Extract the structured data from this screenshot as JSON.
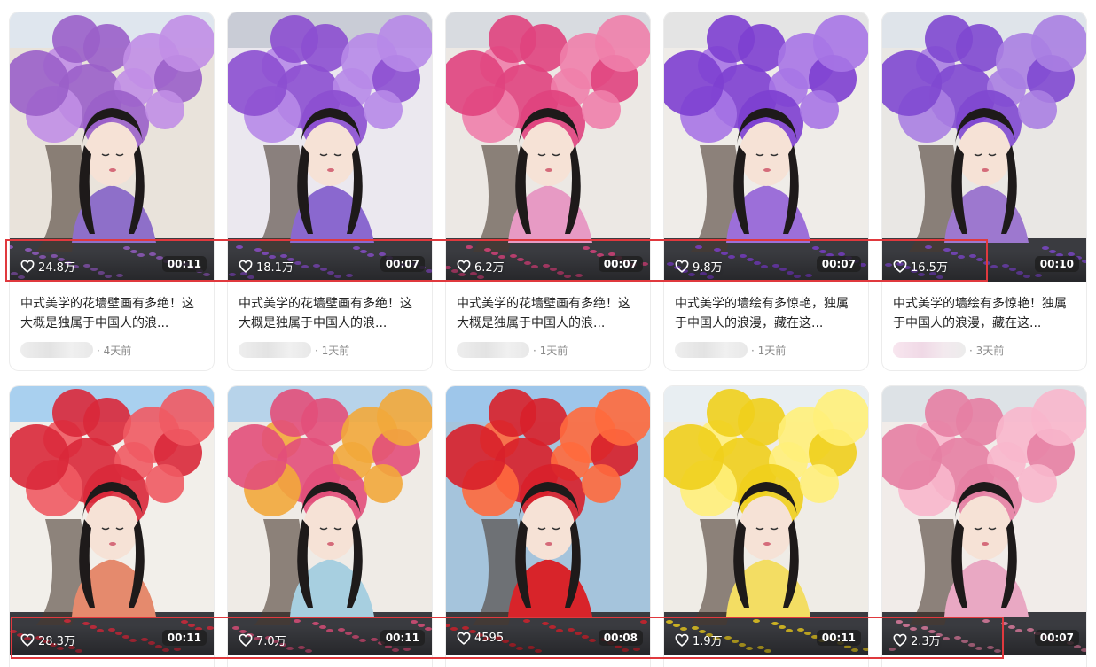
{
  "cards": [
    {
      "likes": "24.8万",
      "duration": "00:11",
      "title": "中式美学的花墙壁画有多绝！这大概是独属于中国人的浪...",
      "time": "· 4天前",
      "flower": "#9a5fc9",
      "flower2": "#c18ee6",
      "dress": "#8e6fc9",
      "wall": "#e9e3db",
      "sky": "#dfe6ee"
    },
    {
      "likes": "18.1万",
      "duration": "00:07",
      "title": "中式美学的花墙壁画有多绝！这大概是独属于中国人的浪...",
      "time": "· 1天前",
      "flower": "#8c4fd0",
      "flower2": "#b78ae8",
      "dress": "#8a68cf",
      "wall": "#ebe8ef",
      "sky": "#c9ccd6"
    },
    {
      "likes": "6.2万",
      "duration": "00:07",
      "title": "中式美学的花墙壁画有多绝！这大概是独属于中国人的浪...",
      "time": "· 1天前",
      "flower": "#e0437e",
      "flower2": "#f07fab",
      "dress": "#e79ac4",
      "wall": "#ece8e4",
      "sky": "#d8dbe0"
    },
    {
      "likes": "9.8万",
      "duration": "00:07",
      "title": "中式美学的墙绘有多惊艳，独属于中国人的浪漫，藏在这...",
      "time": "· 1天前",
      "flower": "#7d3fd0",
      "flower2": "#a775e6",
      "dress": "#9c6fd9",
      "wall": "#efece8",
      "sky": "#e4e4e4"
    },
    {
      "likes": "16.5万",
      "duration": "00:10",
      "title": "中式美学的墙绘有多惊艳！独属于中国人的浪漫，藏在这...",
      "time": "· 3天前",
      "flower": "#8048d0",
      "flower2": "#aa7fe2",
      "dress": "#9d78cf",
      "wall": "#e9e7e4",
      "sky": "#dfe4ea"
    },
    {
      "likes": "28.3万",
      "duration": "00:11",
      "title": "",
      "time": "",
      "flower": "#d9283a",
      "flower2": "#ef5a63",
      "dress": "#e58a6d",
      "wall": "#f2efea",
      "sky": "#a9d0ef"
    },
    {
      "likes": "7.0万",
      "duration": "00:11",
      "title": "",
      "time": "",
      "flower": "#e24f7a",
      "flower2": "#f2a93b",
      "dress": "#a7cfe0",
      "wall": "#efebe6",
      "sky": "#b7d3ea"
    },
    {
      "likes": "4595",
      "duration": "00:08",
      "title": "",
      "time": "",
      "flower": "#d8202a",
      "flower2": "#ff6a3d",
      "dress": "#d8242a",
      "wall": "#a5c4dc",
      "sky": "#9ec6ea"
    },
    {
      "likes": "1.9万",
      "duration": "00:11",
      "title": "",
      "time": "",
      "flower": "#f0cf1c",
      "flower2": "#fff07a",
      "dress": "#f3dd63",
      "wall": "#efece6",
      "sky": "#e8eef2"
    },
    {
      "likes": "2.3万",
      "duration": "00:07",
      "title": "",
      "time": "",
      "flower": "#e57fa3",
      "flower2": "#f8b7cc",
      "dress": "#e9a8c3",
      "wall": "#f1ece9",
      "sky": "#dde2e6"
    }
  ],
  "colors": {
    "highlight": "#e0393e"
  }
}
